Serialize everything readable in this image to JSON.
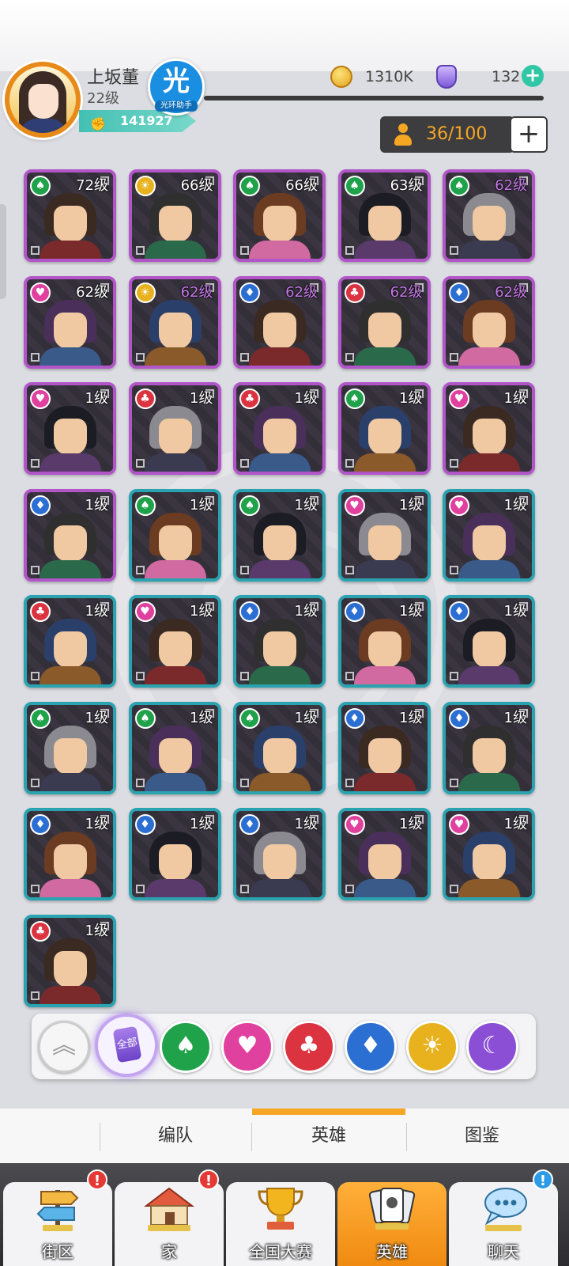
{
  "player": {
    "name": "上坂董",
    "level": "22级",
    "power": "141927",
    "badge_char": "光",
    "badge_caption": "光环助手"
  },
  "currency": {
    "coins": "1310K",
    "gems": "132",
    "gem_plus": "+"
  },
  "capacity": {
    "text": "36/100",
    "plus": "+"
  },
  "heroes": [
    {
      "level": "72级",
      "suit": "spade-icon",
      "suit_color": "green",
      "rarity": "purple",
      "highlight": false
    },
    {
      "level": "66级",
      "suit": "sun-icon",
      "suit_color": "gold",
      "rarity": "purple",
      "highlight": false
    },
    {
      "level": "66级",
      "suit": "spade-icon",
      "suit_color": "green",
      "rarity": "purple",
      "highlight": false
    },
    {
      "level": "63级",
      "suit": "spade-icon",
      "suit_color": "green",
      "rarity": "purple",
      "highlight": false
    },
    {
      "level": "62级",
      "suit": "spade-icon",
      "suit_color": "green",
      "rarity": "purple",
      "highlight": true
    },
    {
      "level": "62级",
      "suit": "heart-icon",
      "suit_color": "pink",
      "rarity": "purple",
      "highlight": false
    },
    {
      "level": "62级",
      "suit": "sun-icon",
      "suit_color": "gold",
      "rarity": "purple",
      "highlight": true
    },
    {
      "level": "62级",
      "suit": "diamond-icon",
      "suit_color": "blue",
      "rarity": "purple",
      "highlight": true
    },
    {
      "level": "62级",
      "suit": "club-icon",
      "suit_color": "red",
      "rarity": "purple",
      "highlight": true
    },
    {
      "level": "62级",
      "suit": "diamond-icon",
      "suit_color": "blue",
      "rarity": "purple",
      "highlight": true
    },
    {
      "level": "1级",
      "suit": "heart-icon",
      "suit_color": "pink",
      "rarity": "purple",
      "highlight": false
    },
    {
      "level": "1级",
      "suit": "club-icon",
      "suit_color": "red",
      "rarity": "purple",
      "highlight": false
    },
    {
      "level": "1级",
      "suit": "club-icon",
      "suit_color": "red",
      "rarity": "purple",
      "highlight": false
    },
    {
      "level": "1级",
      "suit": "spade-icon",
      "suit_color": "green",
      "rarity": "purple",
      "highlight": false
    },
    {
      "level": "1级",
      "suit": "heart-icon",
      "suit_color": "pink",
      "rarity": "purple",
      "highlight": false
    },
    {
      "level": "1级",
      "suit": "diamond-icon",
      "suit_color": "blue",
      "rarity": "purple",
      "highlight": false
    },
    {
      "level": "1级",
      "suit": "spade-icon",
      "suit_color": "green",
      "rarity": "teal",
      "highlight": false
    },
    {
      "level": "1级",
      "suit": "spade-icon",
      "suit_color": "green",
      "rarity": "teal",
      "highlight": false
    },
    {
      "level": "1级",
      "suit": "heart-icon",
      "suit_color": "pink",
      "rarity": "teal",
      "highlight": false
    },
    {
      "level": "1级",
      "suit": "heart-icon",
      "suit_color": "pink",
      "rarity": "teal",
      "highlight": false
    },
    {
      "level": "1级",
      "suit": "club-icon",
      "suit_color": "red",
      "rarity": "teal",
      "highlight": false
    },
    {
      "level": "1级",
      "suit": "heart-icon",
      "suit_color": "pink",
      "rarity": "teal",
      "highlight": false
    },
    {
      "level": "1级",
      "suit": "diamond-icon",
      "suit_color": "blue",
      "rarity": "teal",
      "highlight": false
    },
    {
      "level": "1级",
      "suit": "diamond-icon",
      "suit_color": "blue",
      "rarity": "teal",
      "highlight": false
    },
    {
      "level": "1级",
      "suit": "diamond-icon",
      "suit_color": "blue",
      "rarity": "teal",
      "highlight": false
    },
    {
      "level": "1级",
      "suit": "spade-icon",
      "suit_color": "green",
      "rarity": "teal",
      "highlight": false
    },
    {
      "level": "1级",
      "suit": "spade-icon",
      "suit_color": "green",
      "rarity": "teal",
      "highlight": false
    },
    {
      "level": "1级",
      "suit": "spade-icon",
      "suit_color": "green",
      "rarity": "teal",
      "highlight": false
    },
    {
      "level": "1级",
      "suit": "diamond-icon",
      "suit_color": "blue",
      "rarity": "teal",
      "highlight": false
    },
    {
      "level": "1级",
      "suit": "diamond-icon",
      "suit_color": "blue",
      "rarity": "teal",
      "highlight": false
    },
    {
      "level": "1级",
      "suit": "diamond-icon",
      "suit_color": "blue",
      "rarity": "teal",
      "highlight": false
    },
    {
      "level": "1级",
      "suit": "diamond-icon",
      "suit_color": "blue",
      "rarity": "teal",
      "highlight": false
    },
    {
      "level": "1级",
      "suit": "diamond-icon",
      "suit_color": "blue",
      "rarity": "teal",
      "highlight": false
    },
    {
      "level": "1级",
      "suit": "heart-icon",
      "suit_color": "pink",
      "rarity": "teal",
      "highlight": false
    },
    {
      "level": "1级",
      "suit": "heart-icon",
      "suit_color": "pink",
      "rarity": "teal",
      "highlight": false
    },
    {
      "level": "1级",
      "suit": "club-icon",
      "suit_color": "red",
      "rarity": "teal",
      "highlight": false
    }
  ],
  "filters": {
    "collapse": "chevron-up-icon",
    "all_label": "全部",
    "items": [
      {
        "icon": "spade-icon",
        "color": "green"
      },
      {
        "icon": "heart-icon",
        "color": "pink"
      },
      {
        "icon": "club-icon",
        "color": "red"
      },
      {
        "icon": "diamond-icon",
        "color": "blue"
      },
      {
        "icon": "sun-icon",
        "color": "gold"
      },
      {
        "icon": "moon-icon",
        "color": "purple"
      }
    ]
  },
  "sub_tabs": [
    {
      "label": "编队",
      "active": false
    },
    {
      "label": "英雄",
      "active": true
    },
    {
      "label": "图鉴",
      "active": false
    }
  ],
  "nav": [
    {
      "label": "街区",
      "icon": "signpost-icon",
      "alert": "!",
      "alert_color": "red",
      "active": false
    },
    {
      "label": "家",
      "icon": "house-icon",
      "alert": "!",
      "alert_color": "red",
      "active": false
    },
    {
      "label": "全国大赛",
      "icon": "trophy-icon",
      "alert": "",
      "alert_color": "",
      "active": false
    },
    {
      "label": "英雄",
      "icon": "cards-icon",
      "alert": "",
      "alert_color": "",
      "active": true
    },
    {
      "label": "聊天",
      "icon": "chat-bubble-icon",
      "alert": "!",
      "alert_color": "blue",
      "active": false
    }
  ],
  "colors": {
    "accent_orange": "#f5a623",
    "rarity_purple": "#b255c9",
    "rarity_teal": "#2aa3b0",
    "green": "#1fa24a",
    "pink": "#e0409e",
    "red": "#db3340",
    "blue": "#2c6fd3",
    "gold": "#e7b21d",
    "purple": "#8b4fd6"
  }
}
